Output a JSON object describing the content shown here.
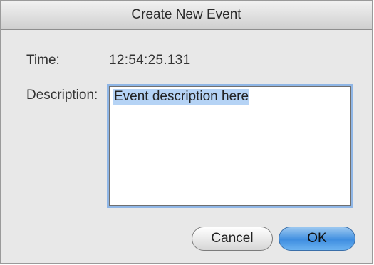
{
  "dialog": {
    "title": "Create New Event"
  },
  "fields": {
    "time_label": "Time:",
    "time_value": "12:54:25.131",
    "description_label": "Description:",
    "description_value": "Event description here"
  },
  "buttons": {
    "cancel_label": "Cancel",
    "ok_label": "OK"
  },
  "colors": {
    "accent": "#3f8ee0",
    "focus_ring": "#8fb6e6",
    "selection": "#b5d3f5"
  }
}
